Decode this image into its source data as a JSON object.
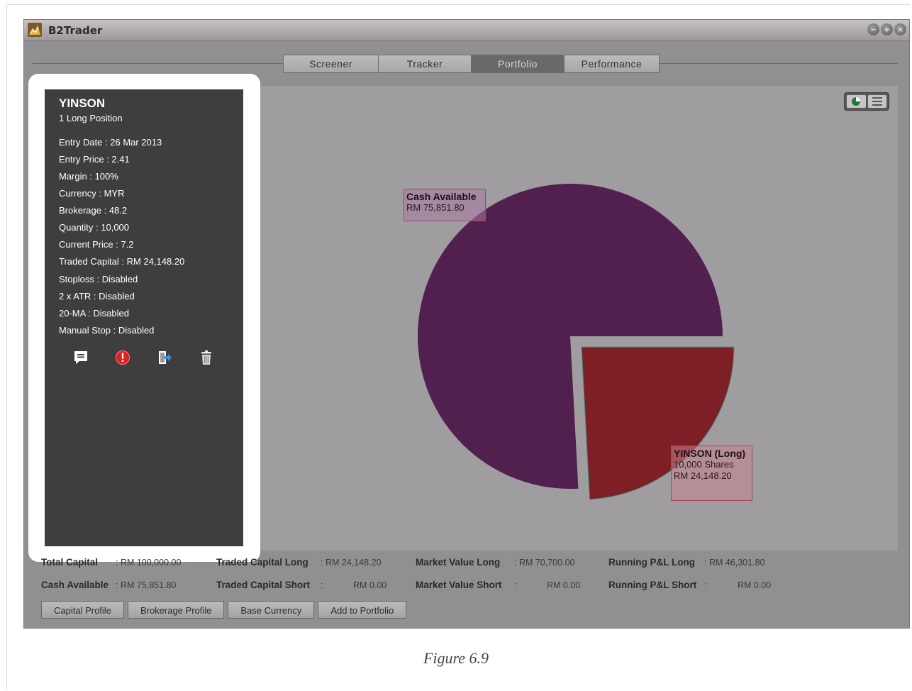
{
  "app": {
    "title": "B2Trader"
  },
  "tabs": [
    {
      "label": "Screener",
      "active": false
    },
    {
      "label": "Tracker",
      "active": false
    },
    {
      "label": "Portfolio",
      "active": true
    },
    {
      "label": "Performance",
      "active": false
    }
  ],
  "position_panel": {
    "symbol": "YINSON",
    "subtitle": "1 Long Position",
    "details": [
      "Entry Date : 26 Mar 2013",
      "Entry Price : 2.41",
      "Margin : 100%",
      "Currency : MYR",
      "Brokerage : 48.2",
      "Quantity : 10,000",
      "Current Price : 7.2",
      "Traded Capital : RM 24,148.20",
      "Stoploss : Disabled",
      "2 x ATR : Disabled",
      "20-MA : Disabled",
      "Manual Stop : Disabled"
    ],
    "actions": [
      "comment-icon",
      "alert-icon",
      "exit-icon",
      "trash-icon"
    ]
  },
  "chart_data": {
    "type": "pie",
    "slices": [
      {
        "label": "Cash Available",
        "value": 75851.8,
        "display": "RM 75,851.80",
        "color": "#52204f"
      },
      {
        "label": "YINSON (Long)",
        "value": 24148.2,
        "display": "RM 24,148.20",
        "shares": "10,000 Shares",
        "color": "#7d1f24"
      }
    ]
  },
  "summary": {
    "total_capital_label": "Total Capital",
    "total_capital_value": ": RM 100,000.00",
    "cash_available_label": "Cash Available",
    "cash_available_value": ":   RM 75,851.80",
    "traded_long_label": "Traded Capital Long",
    "traded_long_value": ": RM 24,148.20",
    "traded_short_label": "Traded Capital Short",
    "traded_short_sep": ":",
    "traded_short_value": "RM 0.00",
    "mv_long_label": "Market Value Long",
    "mv_long_value": ": RM 70,700.00",
    "mv_short_label": "Market Value Short",
    "mv_short_sep": ":",
    "mv_short_value": "RM 0.00",
    "pnl_long_label": "Running P&L Long",
    "pnl_long_value": ": RM 46,301.80",
    "pnl_short_label": "Running P&L Short",
    "pnl_short_sep": ":",
    "pnl_short_value": "RM 0.00"
  },
  "buttons": {
    "capital_profile": "Capital Profile",
    "brokerage_profile": "Brokerage Profile",
    "base_currency": "Base Currency",
    "add_to_portfolio": "Add to Portfolio"
  },
  "caption": "Figure 6.9"
}
